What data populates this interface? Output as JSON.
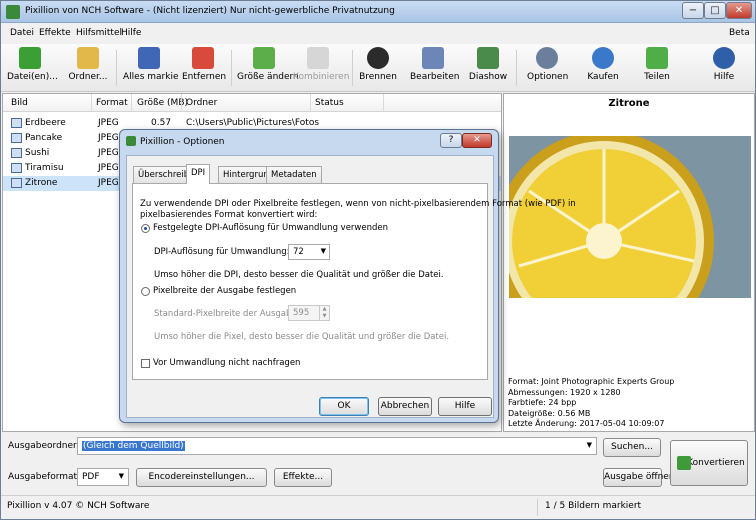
{
  "window": {
    "title": "Pixillion von NCH Software - (Nicht lizenziert) Nur nicht-gewerbliche Privatnutzung",
    "min_glyph": "−",
    "max_glyph": "□",
    "close_glyph": "✕"
  },
  "menu": {
    "items": [
      "Datei",
      "Effekte",
      "Hilfsmittel",
      "Hilfe"
    ],
    "right": "Beta"
  },
  "toolbar": {
    "add_files": "Datei(en)...",
    "add_folder": "Ordner...",
    "select_all": "Alles markie",
    "remove": "Entfernen",
    "resize": "Größe ändern",
    "combine": "Kombinieren",
    "burn": "Brennen",
    "edit": "Bearbeiten",
    "slideshow": "Diashow",
    "options": "Optionen",
    "buy": "Kaufen",
    "share": "Teilen",
    "help": "Hilfe"
  },
  "list": {
    "columns": {
      "image": "Bild",
      "format": "Format",
      "size": "Größe (MB)",
      "folder": "Ordner",
      "status": "Status"
    },
    "rows": [
      {
        "name": "Erdbeere",
        "format": "JPEG",
        "size": "0.57",
        "folder": "C:\\Users\\Public\\Pictures\\Fotos"
      },
      {
        "name": "Pancake",
        "format": "JPEG",
        "size": "",
        "folder": ""
      },
      {
        "name": "Sushi",
        "format": "JPEG",
        "size": "",
        "folder": ""
      },
      {
        "name": "Tiramisu",
        "format": "JPEG",
        "size": "",
        "folder": ""
      },
      {
        "name": "Zitrone",
        "format": "JPEG",
        "size": "",
        "folder": ""
      }
    ]
  },
  "preview": {
    "title": "Zitrone",
    "info": [
      "Format: Joint Photographic Experts Group",
      "Abmessungen: 1920 x 1280",
      "Farbtiefe: 24 bpp",
      "Dateigröße: 0.56 MB",
      "Letzte Änderung: 2017-05-04 10:09:07"
    ]
  },
  "bottom": {
    "output_folder_label": "Ausgabeordner:",
    "output_folder_value": "(Gleich dem Quellbild)",
    "search_button": "Suchen...",
    "output_format_label": "Ausgabeformat:",
    "output_format_value": "PDF",
    "encoder_button": "Encodereinstellungen...",
    "effects_button": "Effekte...",
    "open_output_button": "Ausgabe öffnen",
    "convert_button": "Konvertieren"
  },
  "status": {
    "left": "Pixillion v 4.07 © NCH Software",
    "right": "1 / 5 Bildern markiert"
  },
  "dialog": {
    "title": "Pixillion - Optionen",
    "help_glyph": "?",
    "close_glyph": "✕",
    "tabs": [
      "Überschreiben",
      "DPI",
      "Hintergrund",
      "Metadaten"
    ],
    "intro_line1": "Zu verwendende DPI oder Pixelbreite festlegen, wenn von nicht-pixelbasierendem Format (wie PDF) in",
    "intro_line2": "pixelbasierendes Format konvertiert wird:",
    "radio_fixed_dpi": "Festgelegte DPI-Auflösung für Umwandlung verwenden",
    "dpi_label": "DPI-Auflösung für Umwandlung:",
    "dpi_value": "72",
    "dpi_hint": "Umso höher die DPI, desto besser die Qualität und größer die Datei.",
    "radio_pixel_width": "Pixelbreite der Ausgabe festlegen",
    "pixel_label": "Standard-Pixelbreite der Ausgabe:",
    "pixel_value": "595",
    "pixel_hint": "Umso höher die Pixel, desto besser die Qualität und größer die Datei.",
    "no_ask": "Vor Umwandlung nicht nachfragen",
    "ok": "OK",
    "cancel": "Abbrechen",
    "help": "Hilfe"
  }
}
